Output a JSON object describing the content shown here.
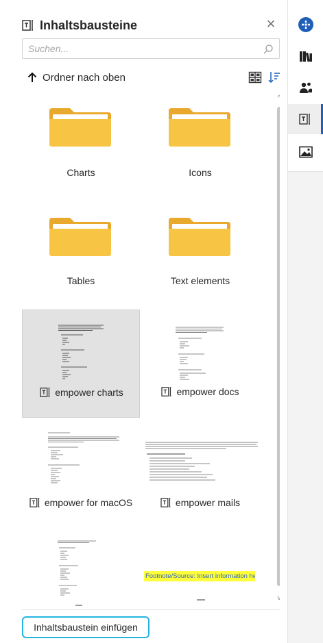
{
  "panel": {
    "title": "Inhaltsbausteine",
    "close_glyph": "×"
  },
  "search": {
    "placeholder": "Suchen...",
    "value": ""
  },
  "toolbar": {
    "up_label": "Ordner nach oben"
  },
  "folders": [
    {
      "label": "Charts"
    },
    {
      "label": "Icons"
    },
    {
      "label": "Tables"
    },
    {
      "label": "Text elements"
    }
  ],
  "documents": [
    {
      "label": "empower charts",
      "selected": true
    },
    {
      "label": "empower docs",
      "selected": false
    },
    {
      "label": "empower for macOS",
      "selected": false
    },
    {
      "label": "empower mails",
      "selected": false
    }
  ],
  "partial_tiles": {
    "highlight_text": "Footnote/Source: Insert information here"
  },
  "footer": {
    "insert_label": "Inhaltsbaustein einfügen"
  },
  "rail": {
    "items": [
      {
        "icon": "empower-logo-icon",
        "active": false
      },
      {
        "icon": "library-icon",
        "active": false
      },
      {
        "icon": "contacts-icon",
        "active": false
      },
      {
        "icon": "text-block-icon",
        "active": true
      },
      {
        "icon": "image-icon",
        "active": false
      }
    ]
  },
  "colors": {
    "accent": "#1f5fb8",
    "button_outline": "#25b4e0",
    "folder": "#f7c444",
    "selection": "#e2e2e2"
  }
}
